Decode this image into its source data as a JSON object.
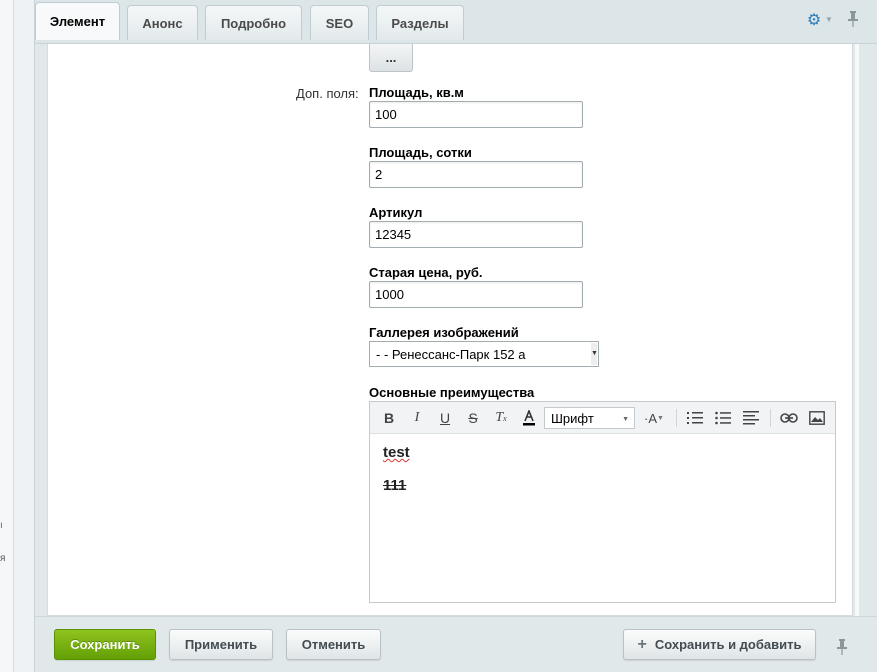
{
  "tabs": [
    {
      "label": "Элемент",
      "active": true
    },
    {
      "label": "Анонс",
      "active": false
    },
    {
      "label": "Подробно",
      "active": false
    },
    {
      "label": "SEO",
      "active": false
    },
    {
      "label": "Разделы",
      "active": false
    }
  ],
  "header_icons": {
    "settings": "gear-icon",
    "pin": "pin-icon"
  },
  "more_button": "...",
  "extra_fields_label": "Доп. поля:",
  "fields": [
    {
      "title": "Площадь, кв.м",
      "value": "100"
    },
    {
      "title": "Площадь, сотки",
      "value": "2"
    },
    {
      "title": "Артикул",
      "value": "12345"
    },
    {
      "title": "Старая цена, руб.",
      "value": "1000"
    }
  ],
  "gallery": {
    "title": "Галлерея изображений",
    "selected": "- - Ренессанс-Парк 152 а"
  },
  "advantages": {
    "title": "Основные преимущества",
    "font_select": "Шрифт",
    "content": [
      "test",
      "111"
    ]
  },
  "toolbar_icons": [
    "bold-icon",
    "italic-icon",
    "underline-icon",
    "strikethrough-icon",
    "clear-format-icon",
    "font-color-icon",
    "font-size-icon",
    "ordered-list-icon",
    "bullet-list-icon",
    "align-icon",
    "link-icon",
    "image-icon"
  ],
  "footer": {
    "save": "Сохранить",
    "apply": "Применить",
    "cancel": "Отменить",
    "save_and_add": "Сохранить и добавить"
  },
  "left_marks": [
    "ı",
    "я"
  ],
  "colors": {
    "primary_button": "#72b012",
    "accent": "#2a7db9"
  }
}
